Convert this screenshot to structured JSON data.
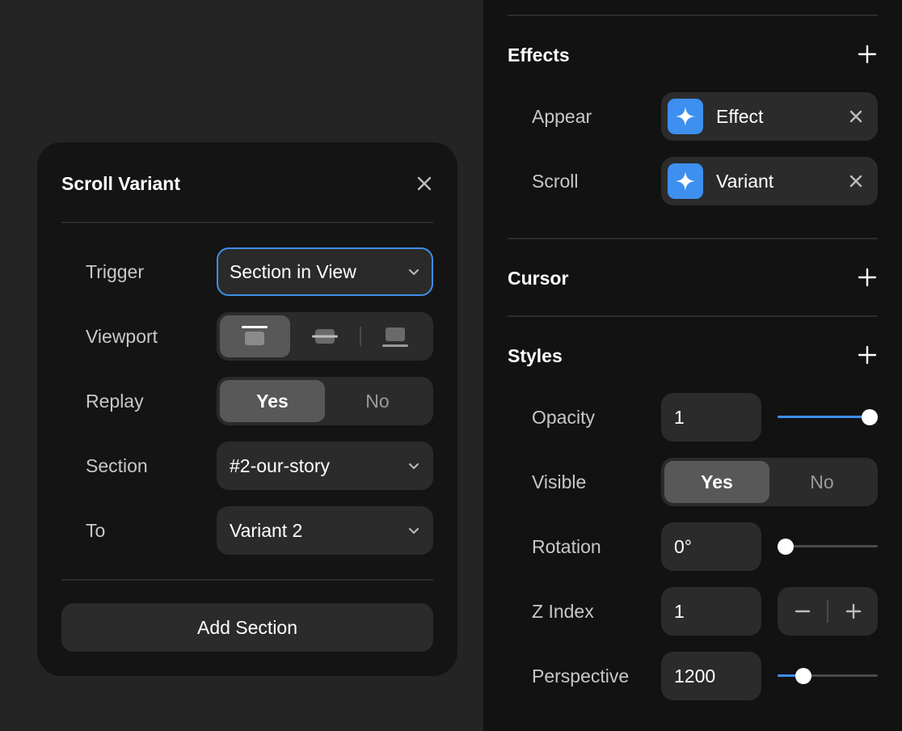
{
  "popover": {
    "title": "Scroll Variant",
    "rows": {
      "trigger": {
        "label": "Trigger",
        "value": "Section in View"
      },
      "viewport": {
        "label": "Viewport",
        "options": [
          "top-align-icon",
          "center-align-icon",
          "bottom-align-icon"
        ],
        "selected": 0
      },
      "replay": {
        "label": "Replay",
        "yes": "Yes",
        "no": "No",
        "selected": "Yes"
      },
      "section": {
        "label": "Section",
        "value": "#2-our-story"
      },
      "to": {
        "label": "To",
        "value": "Variant 2"
      }
    },
    "add_button": "Add Section"
  },
  "side": {
    "effects": {
      "title": "Effects",
      "appear": {
        "label": "Appear",
        "chip": "Effect",
        "icon": "sparkle-icon"
      },
      "scroll": {
        "label": "Scroll",
        "chip": "Variant",
        "icon": "sparkle-icon"
      }
    },
    "cursor": {
      "title": "Cursor"
    },
    "styles": {
      "title": "Styles",
      "opacity": {
        "label": "Opacity",
        "value": "1",
        "slider": 1.0
      },
      "visible": {
        "label": "Visible",
        "yes": "Yes",
        "no": "No",
        "selected": "Yes"
      },
      "rotation": {
        "label": "Rotation",
        "value": "0°",
        "slider": 0.0
      },
      "zindex": {
        "label": "Z Index",
        "value": "1"
      },
      "perspective": {
        "label": "Perspective",
        "value": "1200",
        "slider": 0.21
      }
    }
  },
  "colors": {
    "accent": "#3d8ff0",
    "panel": "#141414",
    "control": "#2b2b2b",
    "canvas": "#242424"
  }
}
